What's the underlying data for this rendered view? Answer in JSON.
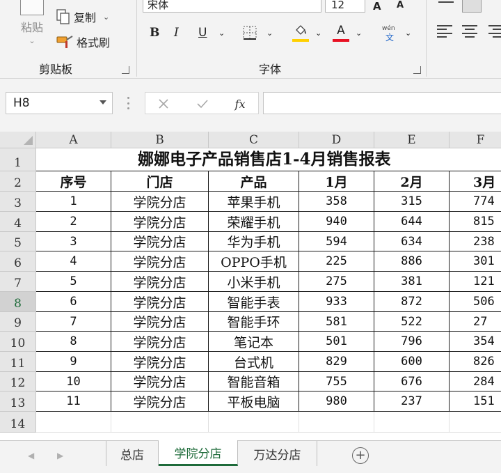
{
  "ribbon": {
    "clipboard": {
      "paste_label": "粘贴",
      "copy_label": "复制",
      "format_painter_label": "格式刷",
      "group_label": "剪贴板"
    },
    "font": {
      "font_name": "宋体",
      "font_size": "12",
      "grow_label": "A",
      "shrink_label": "A",
      "bold_label": "B",
      "italic_label": "I",
      "underline_label": "U",
      "font_color_label": "A",
      "phonetic_top": "wén",
      "phonetic_bottom": "文",
      "fill_color": "#ffd000",
      "font_color": "#e81123",
      "group_label": "字体"
    }
  },
  "formula_bar": {
    "name_box": "H8",
    "fx_label": "fx",
    "formula": ""
  },
  "grid": {
    "columns": [
      "A",
      "B",
      "C",
      "D",
      "E",
      "F"
    ],
    "rows": [
      "1",
      "2",
      "3",
      "4",
      "5",
      "6",
      "7",
      "8",
      "9",
      "10",
      "11",
      "12",
      "13",
      "14"
    ],
    "selected_row": "8",
    "title": "娜娜电子产品销售店1-4月销售报表",
    "headers": [
      "序号",
      "门店",
      "产品",
      "1月",
      "2月",
      "3月"
    ],
    "data": [
      [
        "1",
        "学院分店",
        "苹果手机",
        "358",
        "315",
        "774"
      ],
      [
        "2",
        "学院分店",
        "荣耀手机",
        "940",
        "644",
        "815"
      ],
      [
        "3",
        "学院分店",
        "华为手机",
        "594",
        "634",
        "238"
      ],
      [
        "4",
        "学院分店",
        "OPPO手机",
        "225",
        "886",
        "301"
      ],
      [
        "5",
        "学院分店",
        "小米手机",
        "275",
        "381",
        "121"
      ],
      [
        "6",
        "学院分店",
        "智能手表",
        "933",
        "872",
        "506"
      ],
      [
        "7",
        "学院分店",
        "智能手环",
        "581",
        "522",
        "27"
      ],
      [
        "8",
        "学院分店",
        "笔记本",
        "501",
        "796",
        "354"
      ],
      [
        "9",
        "学院分店",
        "台式机",
        "829",
        "600",
        "826"
      ],
      [
        "10",
        "学院分店",
        "智能音箱",
        "755",
        "676",
        "284"
      ],
      [
        "11",
        "学院分店",
        "平板电脑",
        "980",
        "237",
        "151"
      ]
    ]
  },
  "sheets": {
    "tabs": [
      "总店",
      "学院分店",
      "万达分店"
    ],
    "active": "学院分店",
    "accent": "#1e6b3a"
  }
}
